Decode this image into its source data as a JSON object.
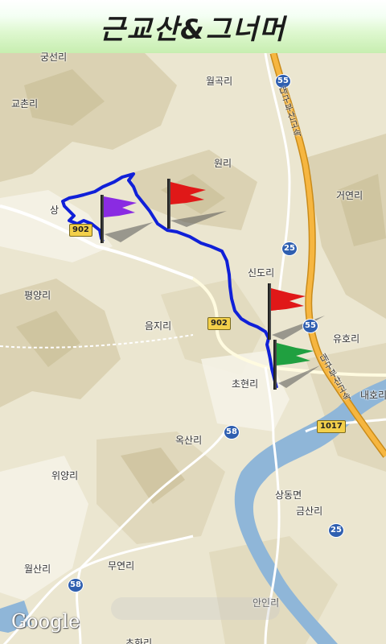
{
  "header": {
    "title": "근교산&그너머"
  },
  "map": {
    "attribution": "Google",
    "labels": [
      {
        "id": "gongseonri",
        "text": "궁선리"
      },
      {
        "id": "wolgokri",
        "text": "월곡리"
      },
      {
        "id": "gyochonri",
        "text": "교촌리"
      },
      {
        "id": "wonri",
        "text": "원리"
      },
      {
        "id": "geoyeonri",
        "text": "거연리"
      },
      {
        "id": "sang",
        "text": "상"
      },
      {
        "id": "sindori",
        "text": "신도리"
      },
      {
        "id": "pyeongyangri",
        "text": "평양리"
      },
      {
        "id": "eumjiri",
        "text": "음지리"
      },
      {
        "id": "yuhori",
        "text": "유호리"
      },
      {
        "id": "chohyeonri",
        "text": "초현리"
      },
      {
        "id": "naehori",
        "text": "내호리"
      },
      {
        "id": "oksanri",
        "text": "옥산리"
      },
      {
        "id": "wiyangri",
        "text": "위양리"
      },
      {
        "id": "sangdongmyeon",
        "text": "상동면"
      },
      {
        "id": "geumsanri",
        "text": "금산리"
      },
      {
        "id": "wolsanri",
        "text": "월산리"
      },
      {
        "id": "muyeonri",
        "text": "무연리"
      },
      {
        "id": "aninri",
        "text": "안인리"
      },
      {
        "id": "chohwari",
        "text": "초화리"
      }
    ],
    "shields": [
      {
        "id": "r55a",
        "text": "55"
      },
      {
        "id": "r902a",
        "text": "902"
      },
      {
        "id": "r25a",
        "text": "25"
      },
      {
        "id": "r902b",
        "text": "902"
      },
      {
        "id": "r55b",
        "text": "55"
      },
      {
        "id": "r58a",
        "text": "58"
      },
      {
        "id": "r1017",
        "text": "1017"
      },
      {
        "id": "r25b",
        "text": "25"
      },
      {
        "id": "r58b",
        "text": "58"
      }
    ],
    "highway_labels": {
      "top": "대구부산고속",
      "bottom": "대구부산고속"
    },
    "colors": {
      "route": "#1020d8",
      "flag_purple": "#8a2be2",
      "flag_red": "#e01818",
      "flag_green": "#20a040",
      "highway": "#f6b640",
      "water": "#8fb6d8",
      "terrain": "#e9e2cc"
    },
    "icons": {
      "start_flag": "purple-flag-icon",
      "summit_flag": "red-flag-icon",
      "end_flag": "green-flag-icon"
    }
  }
}
